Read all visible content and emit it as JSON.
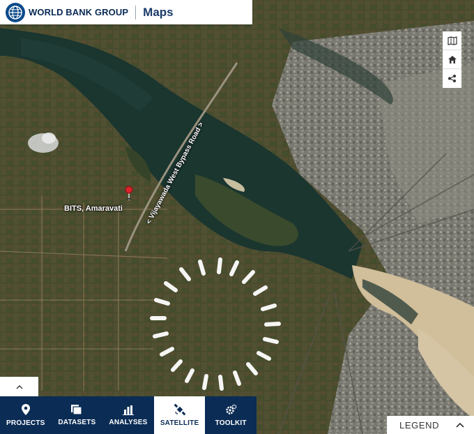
{
  "header": {
    "org_name": "WORLD BANK GROUP",
    "app_name": "Maps"
  },
  "map": {
    "view": "satellite",
    "place_label": "BITS, Amaravati",
    "road_label": "< Vijayawada West Bypass Road >",
    "marker_color": "#d8232a",
    "loading": true
  },
  "map_tools": [
    "map-icon",
    "home-icon",
    "share-icon"
  ],
  "nav": {
    "items": [
      {
        "label": "PROJECTS",
        "icon": "location-pin-icon",
        "active": false
      },
      {
        "label": "DATASETS",
        "icon": "datasets-icon",
        "active": false
      },
      {
        "label": "ANALYSES",
        "icon": "bar-chart-icon",
        "active": false
      },
      {
        "label": "SATELLITE",
        "icon": "satellite-icon",
        "active": true
      },
      {
        "label": "TOOLKIT",
        "icon": "toolkit-icon",
        "active": false
      }
    ]
  },
  "legend": {
    "label": "LEGEND"
  },
  "colors": {
    "nav_background": "#0b2c55",
    "nav_active": "#ffffff",
    "brand": "#0a4a8a"
  }
}
